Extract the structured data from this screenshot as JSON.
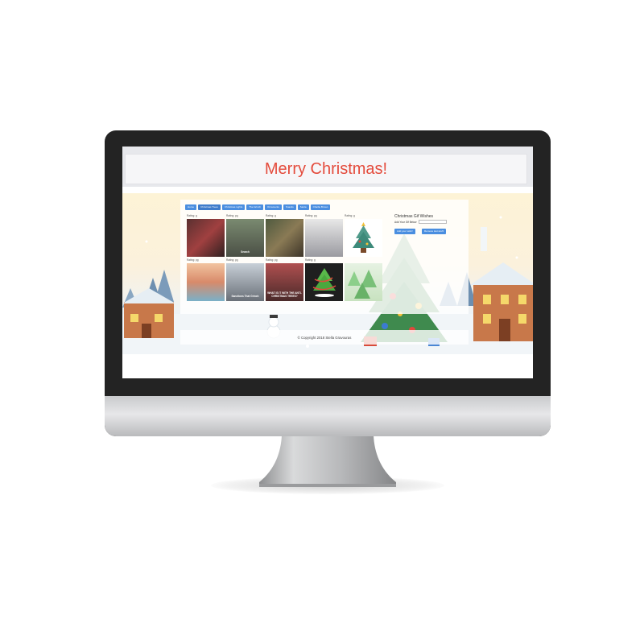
{
  "site": {
    "title": "Merry Christmas!"
  },
  "nav": {
    "items": [
      {
        "label": "Home"
      },
      {
        "label": "Christmas Trees"
      },
      {
        "label": "Christmas Lights"
      },
      {
        "label": "The Grinch"
      },
      {
        "label": "Ornaments"
      },
      {
        "label": "Snacks"
      },
      {
        "label": "Santa"
      },
      {
        "label": "Charlie Brown"
      }
    ],
    "active_index": 1
  },
  "gallery": {
    "items": [
      {
        "rating": "Rating: g",
        "caption": "",
        "icon": "photo"
      },
      {
        "rating": "Rating: pg",
        "caption": "Search",
        "icon": "photo"
      },
      {
        "rating": "Rating: g",
        "caption": "",
        "icon": "photo"
      },
      {
        "rating": "Rating: pg",
        "caption": "",
        "icon": "photo"
      },
      {
        "rating": "Rating: g",
        "caption": "",
        "icon": "christmas-tree-illustration"
      },
      {
        "rating": "Rating: pg",
        "caption": "",
        "icon": "grinch-chair-illustration"
      },
      {
        "rating": "Rating: pg",
        "caption": "",
        "icon": "photo"
      },
      {
        "rating": "Rating: pg",
        "caption": "Sanctions That Grinch",
        "icon": "photo"
      },
      {
        "rating": "Rating: g",
        "caption": "WHAT IS IT WITH THE ANTI-CHRISTMAS TREES?",
        "icon": "photo"
      },
      {
        "rating": "Rating: g",
        "caption": "",
        "icon": "dancing-tree-illustration"
      },
      {
        "rating": "",
        "caption": "",
        "icon": "green-tree-illustration"
      }
    ]
  },
  "sidebar": {
    "title": "Christmas Gif Wishes",
    "input_label": "Add Your Gif Below",
    "input_value": "",
    "add_button": "Add your wish!",
    "remove_button": "Remove last wish!"
  },
  "footer": {
    "text": "© Copyright 2018 Stella Gravouras"
  },
  "colors": {
    "title": "#e44b3c",
    "nav_button": "#4a8ee0",
    "bezel": "#232323",
    "chin": "#d6d7d9"
  }
}
